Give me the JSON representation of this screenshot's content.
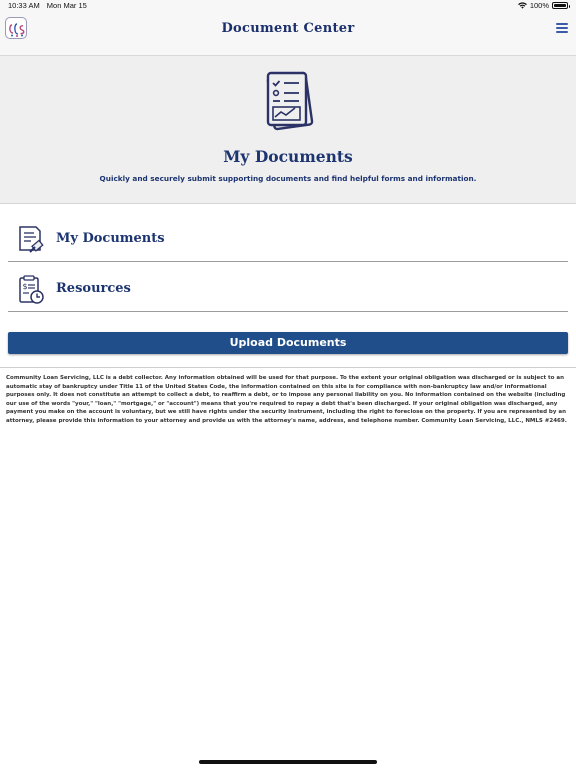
{
  "status_bar": {
    "time": "10:33 AM",
    "date": "Mon Mar 15",
    "battery": "100%"
  },
  "nav": {
    "title": "Document Center",
    "logo_icon": "company-logo",
    "menu_icon": "hamburger-menu-icon"
  },
  "hero": {
    "icon": "document-checklist-icon",
    "title": "My Documents",
    "subtitle": "Quickly and securely submit supporting documents and find helpful forms and information."
  },
  "list": [
    {
      "label": "My Documents",
      "icon": "document-upload-icon"
    },
    {
      "label": "Resources",
      "icon": "resources-calculator-icon"
    }
  ],
  "upload_button": {
    "label": "Upload Documents"
  },
  "disclaimer": "Community Loan Servicing, LLC is a debt collector. Any information obtained will be used for that purpose. To the extent your original obligation was discharged or is subject to an automatic stay of bankruptcy under Title 11 of the United States Code, the information contained on this site is for compliance with non-bankruptcy law and/or informational purposes only. It does not constitute an attempt to collect a debt, to reaffirm a debt, or to impose any personal liability on you. No information contained on the website (including our use of the words \"your,\" \"loan,\" \"mortgage,\" or \"account\") means that you're required to repay a debt that's been discharged. If your original obligation was discharged, any payment you make on the account is voluntary, but we still have rights under the security instrument, including the right to foreclose on the property. If you are represented by an attorney, please provide this information to your attorney and provide us with the attorney's name, address, and telephone number. Community Loan Servicing, LLC., NMLS #2469.",
  "colors": {
    "brand_navy": "#1c3470",
    "button_blue": "#1f4e8b",
    "background_gray": "#efefef"
  }
}
